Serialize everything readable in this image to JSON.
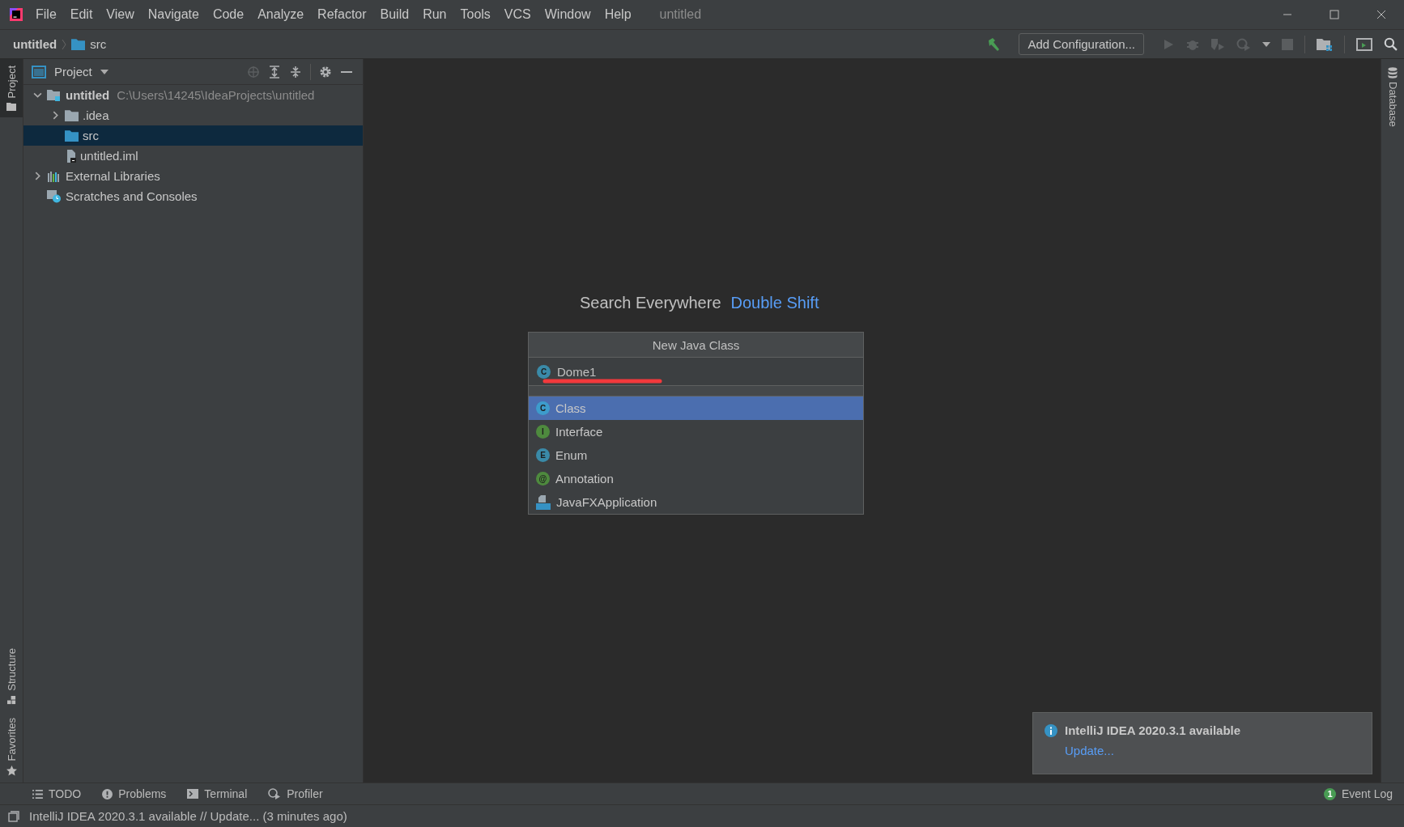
{
  "menu": [
    "File",
    "Edit",
    "View",
    "Navigate",
    "Code",
    "Analyze",
    "Refactor",
    "Build",
    "Run",
    "Tools",
    "VCS",
    "Window",
    "Help"
  ],
  "window_title": "untitled",
  "breadcrumb": [
    {
      "label": "untitled",
      "kind": "project"
    },
    {
      "label": "src",
      "kind": "folder"
    }
  ],
  "toolbar": {
    "run_config": "Add Configuration..."
  },
  "left_stripe": [
    {
      "label": "Project",
      "selected": true,
      "kind": "project"
    },
    {
      "label": "Structure",
      "selected": false,
      "kind": "structure"
    },
    {
      "label": "Favorites",
      "selected": false,
      "kind": "favorites"
    }
  ],
  "right_stripe": [
    "Database"
  ],
  "project_panel": {
    "title": "Project",
    "tree": [
      {
        "label": "untitled",
        "path": "C:\\Users\\14245\\IdeaProjects\\untitled",
        "kind": "module",
        "expanded": true,
        "selected": false,
        "children": [
          {
            "label": ".idea",
            "kind": "folder",
            "expanded": false,
            "selected": false
          },
          {
            "label": "src",
            "kind": "source",
            "selected": true
          },
          {
            "label": "untitled.iml",
            "kind": "file",
            "selected": false
          }
        ]
      },
      {
        "label": "External Libraries",
        "kind": "libraries",
        "expanded": false,
        "selected": false
      },
      {
        "label": "Scratches and Consoles",
        "kind": "scratches",
        "selected": false
      }
    ]
  },
  "hint": {
    "text": "Search Everywhere",
    "shortcut": "Double Shift"
  },
  "dialog": {
    "title": "New Java Class",
    "icon": "C",
    "value": "Dome1",
    "options": [
      {
        "label": "Class",
        "kind": "class",
        "icon": "C",
        "selected": true
      },
      {
        "label": "Interface",
        "kind": "interface",
        "icon": "I",
        "selected": false
      },
      {
        "label": "Enum",
        "kind": "enum",
        "icon": "E",
        "selected": false
      },
      {
        "label": "Annotation",
        "kind": "annotation",
        "icon": "@",
        "selected": false
      },
      {
        "label": "JavaFXApplication",
        "kind": "javafx",
        "selected": false
      }
    ]
  },
  "notification": {
    "title": "IntelliJ IDEA 2020.3.1 available",
    "link": "Update..."
  },
  "tool_tabs": [
    {
      "label": "TODO",
      "kind": "todo"
    },
    {
      "label": "Problems",
      "kind": "problems"
    },
    {
      "label": "Terminal",
      "kind": "terminal"
    },
    {
      "label": "Profiler",
      "kind": "profiler"
    }
  ],
  "event_log": {
    "label": "Event Log",
    "count": "1"
  },
  "status": "IntelliJ IDEA 2020.3.1 available // Update... (3 minutes ago)"
}
